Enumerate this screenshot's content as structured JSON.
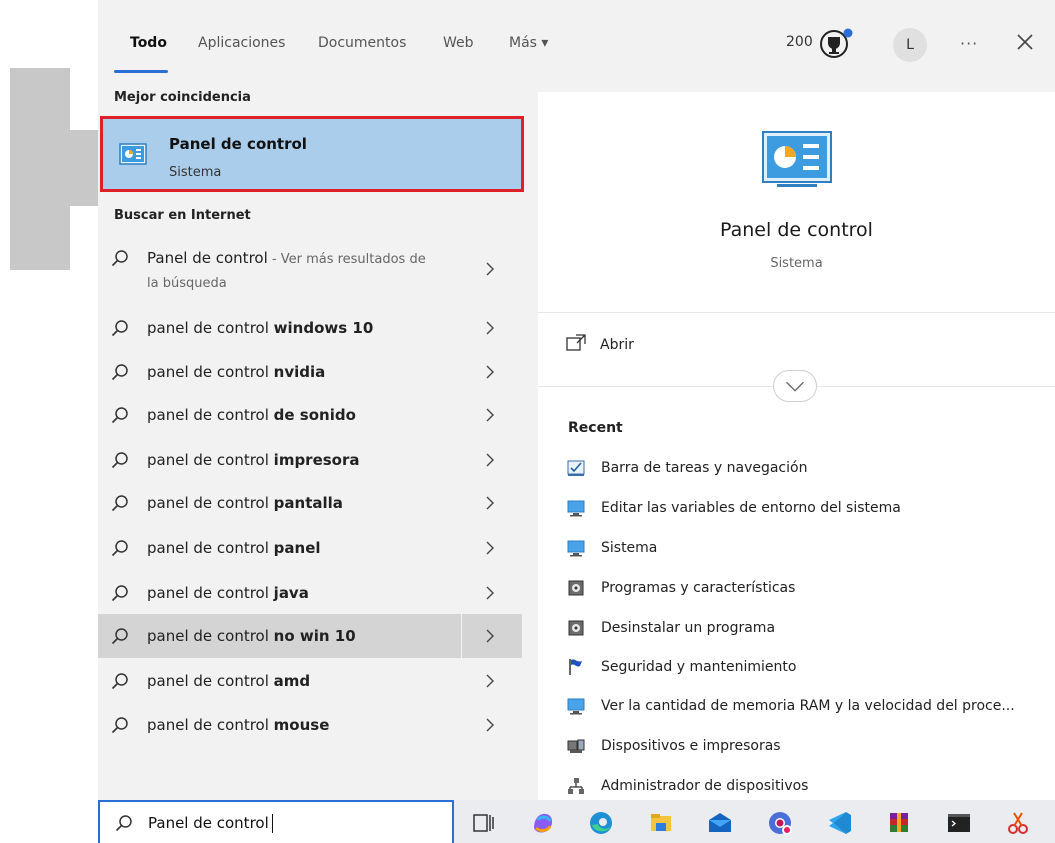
{
  "header": {
    "tabs": [
      "Todo",
      "Aplicaciones",
      "Documentos",
      "Web",
      "Más ▾"
    ],
    "active_tab": "Todo",
    "points": "200",
    "avatar_letter": "L",
    "more_label": "···"
  },
  "left": {
    "best_match_label": "Mejor coincidencia",
    "best_match": {
      "title": "Panel de control",
      "subtitle": "Sistema"
    },
    "web_label": "Buscar en Internet",
    "web_first": {
      "query": "Panel de control",
      "suffix": " - Ver más resultados de",
      "line2": "la búsqueda"
    },
    "suggestions": [
      {
        "prefix": "panel de control ",
        "bold": "windows 10"
      },
      {
        "prefix": "panel de control ",
        "bold": "nvidia"
      },
      {
        "prefix": "panel de control ",
        "bold": "de sonido"
      },
      {
        "prefix": "panel de control ",
        "bold": "impresora"
      },
      {
        "prefix": "panel de control ",
        "bold": "pantalla"
      },
      {
        "prefix": "panel de control ",
        "bold": "panel"
      },
      {
        "prefix": "panel de control ",
        "bold": "java"
      },
      {
        "prefix": "panel de control ",
        "bold": "no win 10"
      },
      {
        "prefix": "panel de control ",
        "bold": "amd"
      },
      {
        "prefix": "panel de control ",
        "bold": "mouse"
      }
    ]
  },
  "right": {
    "title": "Panel de control",
    "subtitle": "Sistema",
    "open_label": "Abrir",
    "recent_label": "Recent",
    "recent_items": [
      "Barra de tareas y navegación",
      "Editar las variables de entorno del sistema",
      "Sistema",
      "Programas y características",
      "Desinstalar un programa",
      "Seguridad y mantenimiento",
      "Ver la cantidad de memoria RAM y la velocidad del proce...",
      "Dispositivos e impresoras",
      "Administrador de dispositivos"
    ]
  },
  "taskbar": {
    "search_value": "Panel de control",
    "icons": [
      "task-view-icon",
      "copilot-icon",
      "edge-icon",
      "file-explorer-icon",
      "mail-icon",
      "chrome-canary-icon",
      "vscode-icon",
      "winrar-icon",
      "terminal-icon",
      "snipping-tool-icon"
    ]
  },
  "colors": {
    "accent": "#2b6fd6",
    "highlight_border": "#e02027",
    "selection": "#a9cdea"
  }
}
